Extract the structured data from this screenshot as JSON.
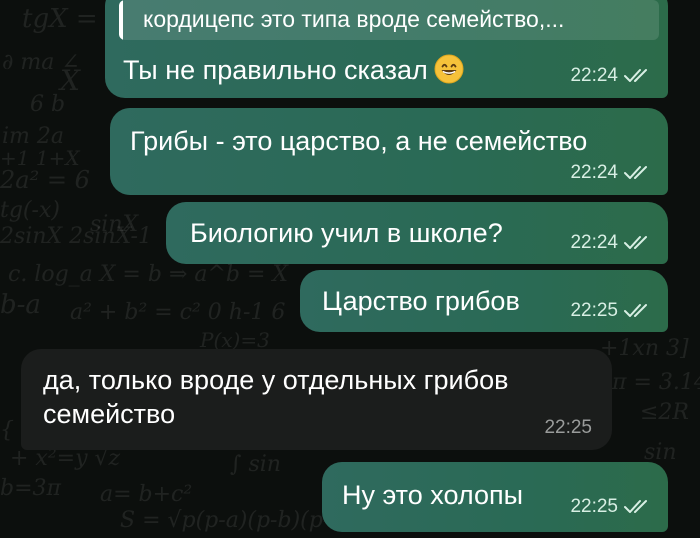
{
  "reply_quote": {
    "text": "кордицепс это типа вроде семейство,..."
  },
  "messages": [
    {
      "text": "Ты не правильно сказал",
      "emoji": "grinning-face-emoji",
      "time": "22:24",
      "direction": "outgoing",
      "status": "read"
    },
    {
      "text": "Грибы - это царство, а не семейство",
      "time": "22:24",
      "direction": "outgoing",
      "status": "read"
    },
    {
      "text": "Биологию учил в школе?",
      "time": "22:24",
      "direction": "outgoing",
      "status": "read"
    },
    {
      "text": "Царство грибов",
      "time": "22:25",
      "direction": "outgoing",
      "status": "read"
    },
    {
      "lines": [
        "да, только вроде у отдельных грибов",
        "семейство"
      ],
      "time": "22:25",
      "direction": "incoming"
    },
    {
      "text": "Ну это холопы",
      "time": "22:25",
      "direction": "outgoing",
      "status": "read"
    }
  ],
  "colors": {
    "outgoing_bubble": "#2c6a55",
    "incoming_bubble": "#1b1d1c",
    "background": "#0c0f0d",
    "quote_bar": "#ffffff"
  },
  "icons": {
    "read_status": "double-check-icon"
  }
}
